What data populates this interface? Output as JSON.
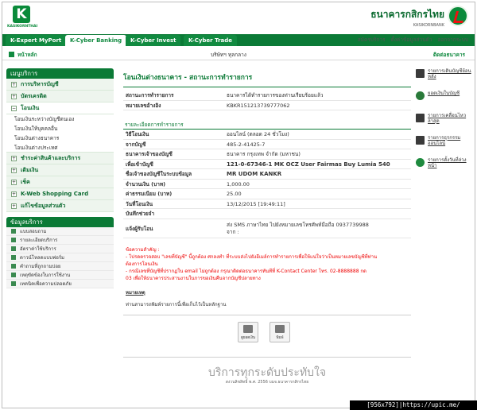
{
  "header": {
    "logo_letter": "K",
    "logo_text": "KASIKORNTHAI",
    "bank_name_thai": "ธนาคารกสิกรไทย",
    "bank_name_eng": "KASIKORNBANK"
  },
  "tabs": [
    {
      "label": "K-Expert MyPort",
      "active": false
    },
    {
      "label": "K-Cyber Banking",
      "active": true
    },
    {
      "label": "K-Cyber Invest",
      "active": false
    },
    {
      "label": "K-Cyber Trade",
      "active": false
    }
  ],
  "toplinks": [
    "สมัครบริการ",
    "ตั้งค่าข้อมูลส่วนตัว",
    "ออกจากระบบ"
  ],
  "subbar": {
    "home": "หน้าหลัก",
    "company": "บริษัทฯ ทุลกลาง",
    "contact": "ติดต่อธนาคาร"
  },
  "sidebar": {
    "menu_title": "เมนูบริการ",
    "items": [
      {
        "label": "การบริหารบัญชี",
        "sign": "+"
      },
      {
        "label": "บัตรเครดิต",
        "sign": "+"
      },
      {
        "label": "โอนเงิน",
        "sign": "−"
      }
    ],
    "subitems": [
      "โอนเงินระหว่างบัญชีตนเอง",
      "โอนเงินให้บุคคลอื่น",
      "โอนเงินต่างธนาคาร",
      "โอนเงินต่างประเทศ"
    ],
    "items2": [
      {
        "label": "ชำระค่าสินค้าและบริการ",
        "sign": "+"
      },
      {
        "label": "เติมเงิน",
        "sign": "+"
      },
      {
        "label": "เช็ค",
        "sign": "+"
      },
      {
        "label": "K-Web Shopping Card",
        "sign": "+"
      },
      {
        "label": "แก้ไขข้อมูลส่วนตัว",
        "sign": "+"
      }
    ],
    "info_title": "ข้อมูลบริการ",
    "info_items": [
      "แบบสอบถาม",
      "รายละเอียดบริการ",
      "อัตราค่าใช้บริการ",
      "ดาวน์โหลดแบบฟอร์ม",
      "คำถามที่ถูกถามบ่อย",
      "เหตุขัดข้องในการใช้งาน",
      "เทคนิคเพื่อความปลอดภัย"
    ]
  },
  "main": {
    "title": "โอนเงินต่างธนาคาร - สถานะการทำรายการ",
    "status_label": "สถานะการทำรายการ",
    "status_value": "ธนาคารได้ทำรายการของท่านเรียบร้อยแล้ว",
    "ref_label": "หมายเลขอ้างอิง",
    "ref_value": "KBKR151213739777062",
    "section_title": "รายละเอียดการทำรายการ",
    "rows": [
      {
        "k": "วิธีโอนเงิน",
        "v": "ออนไลน์ (ตลอด 24 ชั่วโมง)",
        "big": false
      },
      {
        "k": "จากบัญชี",
        "v": "485-2-41425-7",
        "big": false
      },
      {
        "k": "ธนาคารเจ้าของบัญชี",
        "v": "ธนาคาร กรุงเทพ จำกัด (มหาชน)",
        "big": false
      },
      {
        "k": "เพื่อเข้าบัญชี",
        "v": "121-0-67346-1 MK OCZ User Fairmas Buy Lumia 540",
        "big": true
      },
      {
        "k": "ชื่อเจ้าของบัญชีในระบบข้อมูล",
        "v": "MR UDOM KANKR",
        "big": true
      },
      {
        "k": "จำนวนเงิน (บาท)",
        "v": "1,000.00",
        "big": false
      },
      {
        "k": "ค่าธรรมเนียม (บาท)",
        "v": "25.00",
        "big": false
      },
      {
        "k": "วันที่โอนเงิน",
        "v": "13/12/2015 [19:49:11]",
        "big": false
      },
      {
        "k": "บันทึกช่วยจำ",
        "v": "",
        "big": false
      }
    ],
    "notify_label": "แจ้งผู้รับโอน",
    "notify_value_1": "ส่ง SMS ภาษาไทย ไปยังหมายเลขโทรศัพท์มือถือ 0937739988",
    "notify_value_2": "จาก :",
    "note_lines": [
      "ข้อความสำคัญ :",
      "- โปรดตรวจสอบ \"เลขที่บัญชี\" นี้ถูกต้อง ศกลงทำ ที่ระบบส่งไปยังอีเมล์การทำรายการเพื่อให้แน่ใจว่าเป็นหมายเลขบัญชีที่ท่าน",
      "ต้องการโอนเงิน",
      "- กรณีเลขที่บัญชีที่ปรากฏใน email ไม่ถูกต้อง กรุณาติดต่อธนาคารทันทีที่ K-Contact Center โทร. 02-8888888 กด",
      "03 เพื่อให้ธนาคารประสานงานในการขอเงินคืนจากบัญชีปลายทาง"
    ],
    "remark_title": "หมายเหตุ",
    "remark_text": "ท่านสามารถพิมพ์รายการนี้เพื่อเก็บไว้เป็นหลักฐาน",
    "actions": [
      "ดูยอดเงิน",
      "พิมพ์"
    ]
  },
  "right_panel": [
    {
      "label": "รายการเดินบัญชีย้อนหลัง",
      "icon": "document-icon"
    },
    {
      "label": "ยอดเงินในบัญชี",
      "icon": "money-icon"
    },
    {
      "label": "รายการเคลื่อนไหวล่าสุด",
      "icon": "list-icon"
    },
    {
      "label": "รายการธุรกรรมออนไลน์",
      "icon": "list-icon"
    },
    {
      "label": "รายการตั้งวันที่ล่วงหน้า",
      "icon": "clock-icon"
    }
  ],
  "footer": {
    "slogan": "บริการทุกระดับประทับใจ",
    "copyright": "สงวนลิขสิทธิ์ พ.ศ. 2556 บมจ.ธนาคารกสิกรไทย"
  },
  "watermark": "[956x792]|https://upic.me/",
  "colors": {
    "brand_green": "#0b7a36",
    "alert_red": "#e00000"
  }
}
